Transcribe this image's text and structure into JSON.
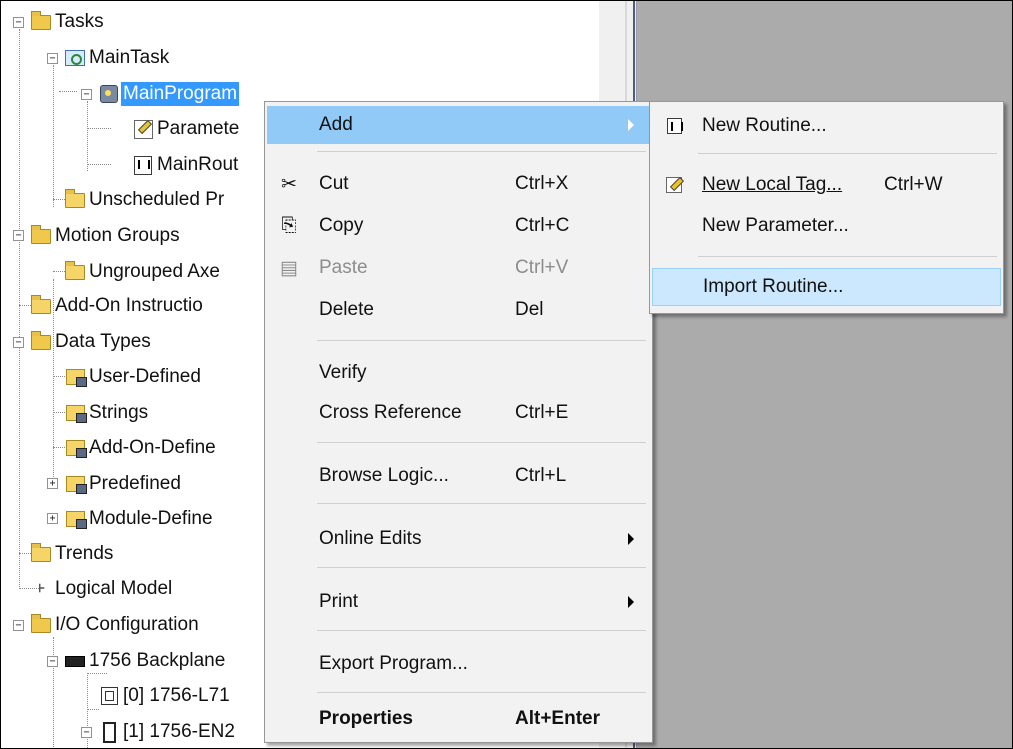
{
  "tree": {
    "items": [
      {
        "label": "Tasks"
      },
      {
        "label": "MainTask"
      },
      {
        "label": "MainProgram"
      },
      {
        "label": "Paramete"
      },
      {
        "label": "MainRout"
      },
      {
        "label": "Unscheduled Pr"
      },
      {
        "label": "Motion Groups"
      },
      {
        "label": "Ungrouped Axe"
      },
      {
        "label": "Add-On Instructio"
      },
      {
        "label": "Data Types"
      },
      {
        "label": "User-Defined"
      },
      {
        "label": "Strings"
      },
      {
        "label": "Add-On-Define"
      },
      {
        "label": "Predefined"
      },
      {
        "label": "Module-Define"
      },
      {
        "label": "Trends"
      },
      {
        "label": "Logical Model"
      },
      {
        "label": "I/O Configuration"
      },
      {
        "label": "1756 Backplane"
      },
      {
        "label": "[0] 1756-L71"
      },
      {
        "label": "[1] 1756-EN2"
      }
    ]
  },
  "context_menu": {
    "items": [
      {
        "label": "Add",
        "shortcut": ""
      },
      {
        "label": "Cut",
        "shortcut": "Ctrl+X"
      },
      {
        "label": "Copy",
        "shortcut": "Ctrl+C"
      },
      {
        "label": "Paste",
        "shortcut": "Ctrl+V"
      },
      {
        "label": "Delete",
        "shortcut": "Del"
      },
      {
        "label": "Verify",
        "shortcut": ""
      },
      {
        "label": "Cross Reference",
        "shortcut": "Ctrl+E"
      },
      {
        "label": "Browse Logic...",
        "shortcut": "Ctrl+L"
      },
      {
        "label": "Online Edits",
        "shortcut": ""
      },
      {
        "label": "Print",
        "shortcut": ""
      },
      {
        "label": "Export Program...",
        "shortcut": ""
      },
      {
        "label": "Properties",
        "shortcut": "Alt+Enter"
      }
    ]
  },
  "submenu": {
    "items": [
      {
        "label": "New Routine...",
        "shortcut": ""
      },
      {
        "label": "New Local Tag...",
        "shortcut": "Ctrl+W"
      },
      {
        "label": "New Parameter...",
        "shortcut": ""
      },
      {
        "label": "Import Routine...",
        "shortcut": ""
      }
    ]
  },
  "colors": {
    "selection": "#3399ff",
    "menu_highlight": "#91c9f7",
    "submenu_highlight": "#cce8ff",
    "workspace": "#ababab"
  }
}
